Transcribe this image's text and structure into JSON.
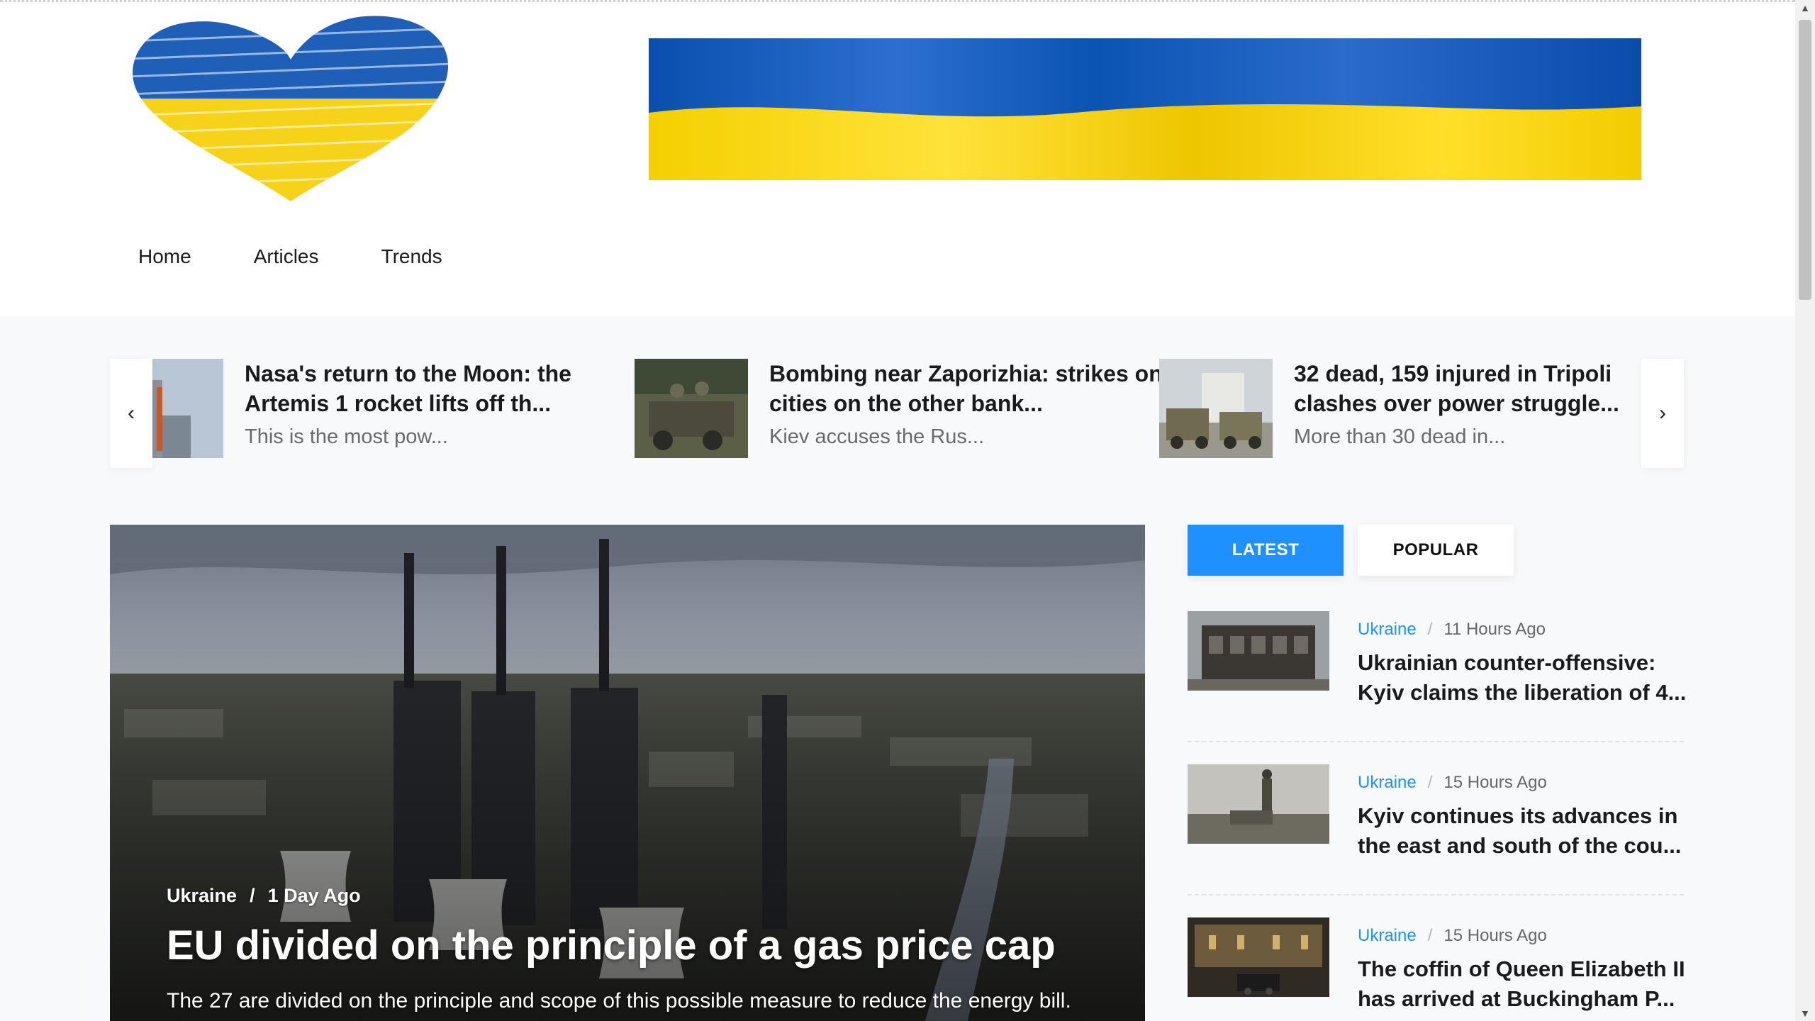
{
  "nav": {
    "items": [
      "Home",
      "Articles",
      "Trends"
    ]
  },
  "ticker": {
    "items": [
      {
        "title": "Nasa's return to the Moon: the Artemis 1 rocket lifts off th...",
        "excerpt": "This is the most pow..."
      },
      {
        "title": "Bombing near Zaporizhia: strikes on cities on the other bank...",
        "excerpt": "Kiev accuses the Rus..."
      },
      {
        "title": "32 dead, 159 injured in Tripoli clashes over power struggle...",
        "excerpt": "More than 30 dead in..."
      }
    ],
    "prev_icon": "chevron-left-icon",
    "next_icon": "chevron-right-icon"
  },
  "hero": {
    "category": "Ukraine",
    "separator": "/",
    "time": "1 Day Ago",
    "title": "EU divided on the principle of a gas price cap",
    "description": "The 27 are divided on the principle and scope of this possible measure to reduce the energy bill."
  },
  "sidebar": {
    "tabs": {
      "latest": "LATEST",
      "popular": "POPULAR"
    },
    "items": [
      {
        "category": "Ukraine",
        "time": "11 Hours Ago",
        "title": "Ukrainian counter-offensive: Kyiv claims the liberation of 4..."
      },
      {
        "category": "Ukraine",
        "time": "15 Hours Ago",
        "title": "Kyiv continues its advances in the east and south of the cou..."
      },
      {
        "category": "Ukraine",
        "time": "15 Hours Ago",
        "title": "The coffin of Queen Elizabeth II has arrived at Buckingham P..."
      }
    ],
    "separator": "/"
  },
  "colors": {
    "accent": "#1e90ff",
    "flag_blue": "#0057b7",
    "flag_yellow": "#ffd700"
  }
}
